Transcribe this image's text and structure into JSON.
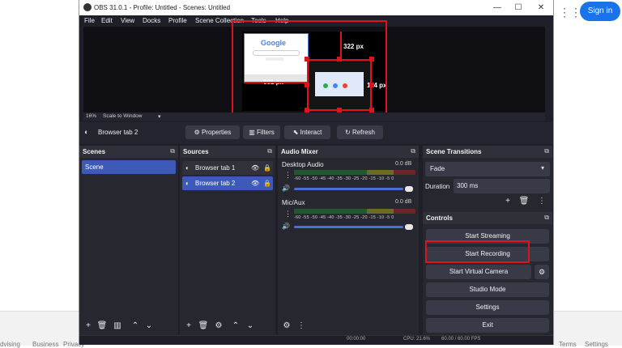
{
  "background_page": {
    "signin_label": "Sign in",
    "footer_links": [
      "dvising",
      "Business",
      "Privacy",
      "Terms",
      "Settings"
    ]
  },
  "window": {
    "title": "OBS 31.0.1 - Profile: Untitled - Scenes: Untitled",
    "controls": [
      "—",
      "☐",
      "✕"
    ]
  },
  "menu": [
    "File",
    "Edit",
    "View",
    "Docks",
    "Profile",
    "Scene Collection",
    "Tools",
    "Help"
  ],
  "preview": {
    "zoom": "16%",
    "scale_mode": "Scale to Window",
    "height_label": "322 px",
    "width_label": "601 px",
    "side_label": "114 px",
    "google_text": "Google"
  },
  "source_toolbar": {
    "current_source": "Browser tab 2",
    "properties_label": "Properties",
    "filters_label": "Filters",
    "interact_label": "Interact",
    "refresh_label": "Refresh"
  },
  "scenes": {
    "title": "Scenes",
    "items": [
      "Scene"
    ]
  },
  "sources": {
    "title": "Sources",
    "items": [
      "Browser tab 1",
      "Browser tab 2"
    ]
  },
  "audio_mixer": {
    "title": "Audio Mixer",
    "tick_labels": "-60 -55 -50 -45 -40 -35 -30 -25 -20 -15 -10  -5   0",
    "channels": [
      {
        "name": "Desktop Audio",
        "level": "0.0 dB"
      },
      {
        "name": "Mic/Aux",
        "level": "0.0 dB"
      }
    ]
  },
  "transitions": {
    "title": "Scene Transitions",
    "type": "Fade",
    "duration_label": "Duration",
    "duration_value": "300 ms"
  },
  "controls": {
    "title": "Controls",
    "buttons": [
      "Start Streaming",
      "Start Recording",
      "Start Virtual Camera",
      "Studio Mode",
      "Settings",
      "Exit"
    ]
  },
  "statusbar": {
    "cpu": "CPU: 21.6%",
    "fps": "60.00 / 60.00 FPS",
    "rec_time": "00:00:00"
  },
  "colors": {
    "accent": "#3d5ab8",
    "highlight_red": "#e0121a",
    "signin_blue": "#1a73e8"
  }
}
